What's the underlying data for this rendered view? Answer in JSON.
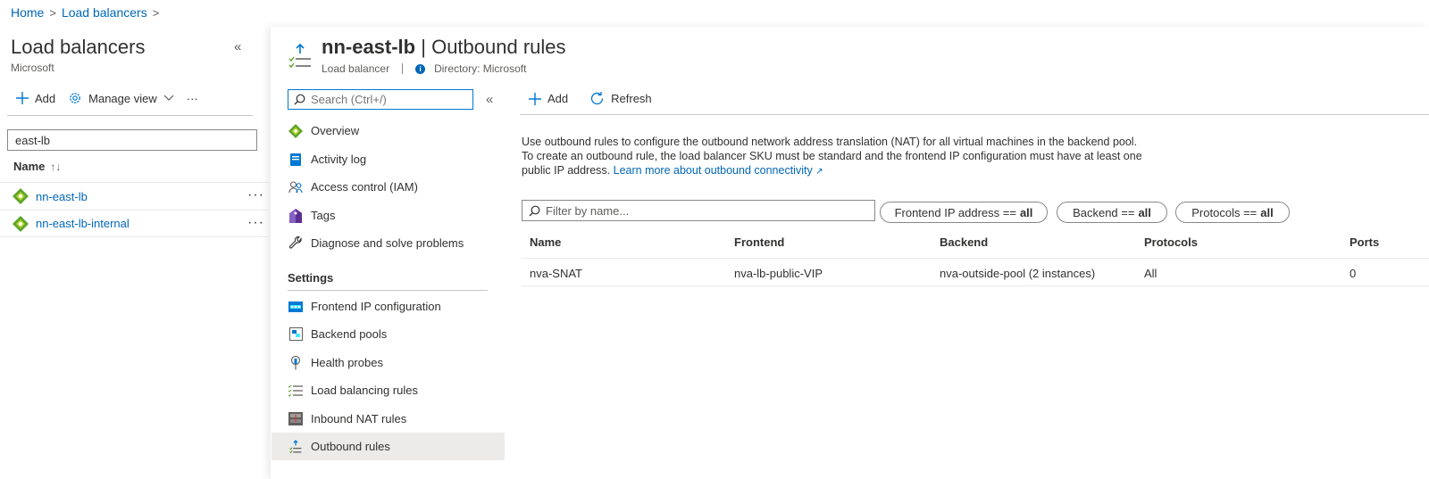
{
  "breadcrumb": {
    "home": "Home",
    "sep1": ">",
    "parent": "Load balancers",
    "sep2": ">"
  },
  "left_blade": {
    "title": "Load balancers",
    "subtitle": "Microsoft",
    "collapse": "«",
    "toolbar": {
      "add": "Add",
      "manage_view": "Manage view",
      "more": "···"
    },
    "filter_value": "east-lb",
    "column_name": "Name",
    "sort_glyph": "↑↓",
    "items": [
      {
        "name": "nn-east-lb",
        "more": "···"
      },
      {
        "name": "nn-east-lb-internal",
        "more": "···"
      }
    ]
  },
  "resource": {
    "name": "nn-east-lb",
    "page": "| Outbound rules",
    "type": "Load balancer",
    "directory": "Directory: Microsoft"
  },
  "menu": {
    "search_placeholder": "Search (Ctrl+/)",
    "collapse": "«",
    "top_items": [
      {
        "label": "Overview",
        "icon": "load-balancer-diamond-icon"
      },
      {
        "label": "Activity log",
        "icon": "activity-log-icon"
      },
      {
        "label": "Access control (IAM)",
        "icon": "people-icon"
      },
      {
        "label": "Tags",
        "icon": "tag-icon"
      },
      {
        "label": "Diagnose and solve problems",
        "icon": "wrench-icon"
      }
    ],
    "section_settings": "Settings",
    "settings_items": [
      {
        "label": "Frontend IP configuration",
        "icon": "frontend-ip-icon"
      },
      {
        "label": "Backend pools",
        "icon": "backend-pool-icon"
      },
      {
        "label": "Health probes",
        "icon": "health-probe-icon"
      },
      {
        "label": "Load balancing rules",
        "icon": "rules-list-icon"
      },
      {
        "label": "Inbound NAT rules",
        "icon": "inbound-nat-icon"
      },
      {
        "label": "Outbound rules",
        "icon": "outbound-rules-icon"
      }
    ]
  },
  "main": {
    "toolbar": {
      "add": "Add",
      "refresh": "Refresh"
    },
    "description": "Use outbound rules to configure the outbound network address translation (NAT) for all virtual machines in the backend pool. To create an outbound rule, the load balancer SKU must be standard and the frontend IP configuration must have at least one public IP address.",
    "learn_more": "Learn more about outbound connectivity",
    "filter_placeholder": "Filter by name...",
    "pills": [
      {
        "label": "Frontend IP address ==",
        "value": "all"
      },
      {
        "label": "Backend ==",
        "value": "all"
      },
      {
        "label": "Protocols ==",
        "value": "all"
      }
    ],
    "columns": [
      "Name",
      "Frontend",
      "Backend",
      "Protocols",
      "Ports"
    ],
    "rows": [
      {
        "name": "nva-SNAT",
        "frontend": "nva-lb-public-VIP",
        "backend": "nva-outside-pool (2 instances)",
        "protocols": "All",
        "ports": "0"
      }
    ]
  },
  "colors": {
    "link": "#0067b8",
    "accent": "#0078d4",
    "lb_green": "#5ea52a",
    "selected_bg": "#edebe9"
  }
}
